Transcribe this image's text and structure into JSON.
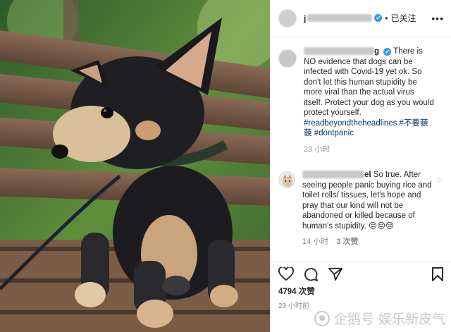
{
  "header": {
    "username_initial": "j",
    "verified_mark": "✔",
    "separator": "•",
    "follow_label": "已关注",
    "more_label": "•••"
  },
  "caption": {
    "username_suffix": "g",
    "verified_mark": "✔",
    "text": "There is NO evidence that dogs can be infected with Covid-19 yet ok. So don't let this human stupidity be more viral than the actual virus itself. Protect your dog as you would protect yourself.",
    "hashtags": "#readbeyondtheheadlines #不要藐藐 #dontpanic",
    "time": "23 小时"
  },
  "reply": {
    "username_suffix": "el",
    "text": "So true. After seeing people panic buying rice and toilet rolls/ tissues, let's hope and pray that our kind will not be abandoned or killed because of human's stupidity. 😔😔😔",
    "time": "14 小时",
    "likes": "3 次赞",
    "like_icon": "♡"
  },
  "actions": {
    "like_icon": "heart-icon",
    "comment_icon": "comment-icon",
    "share_icon": "share-icon",
    "save_icon": "bookmark-icon",
    "likes_count": "4794 次赞",
    "post_time": "23 小时前"
  },
  "watermark": {
    "text": "企鹅号 娱乐新皮气"
  },
  "colors": {
    "verified": "#3897f0",
    "hashtag": "#00376b",
    "muted": "#8e8e8e",
    "border": "#efefef"
  }
}
